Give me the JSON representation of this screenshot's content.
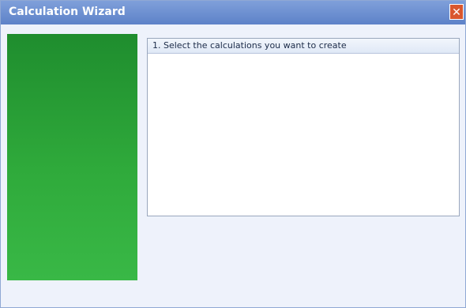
{
  "window": {
    "title": "Calculation Wizard",
    "close_label": "✕"
  },
  "panel": {
    "heading": "1. Select the calculations you want to create"
  }
}
